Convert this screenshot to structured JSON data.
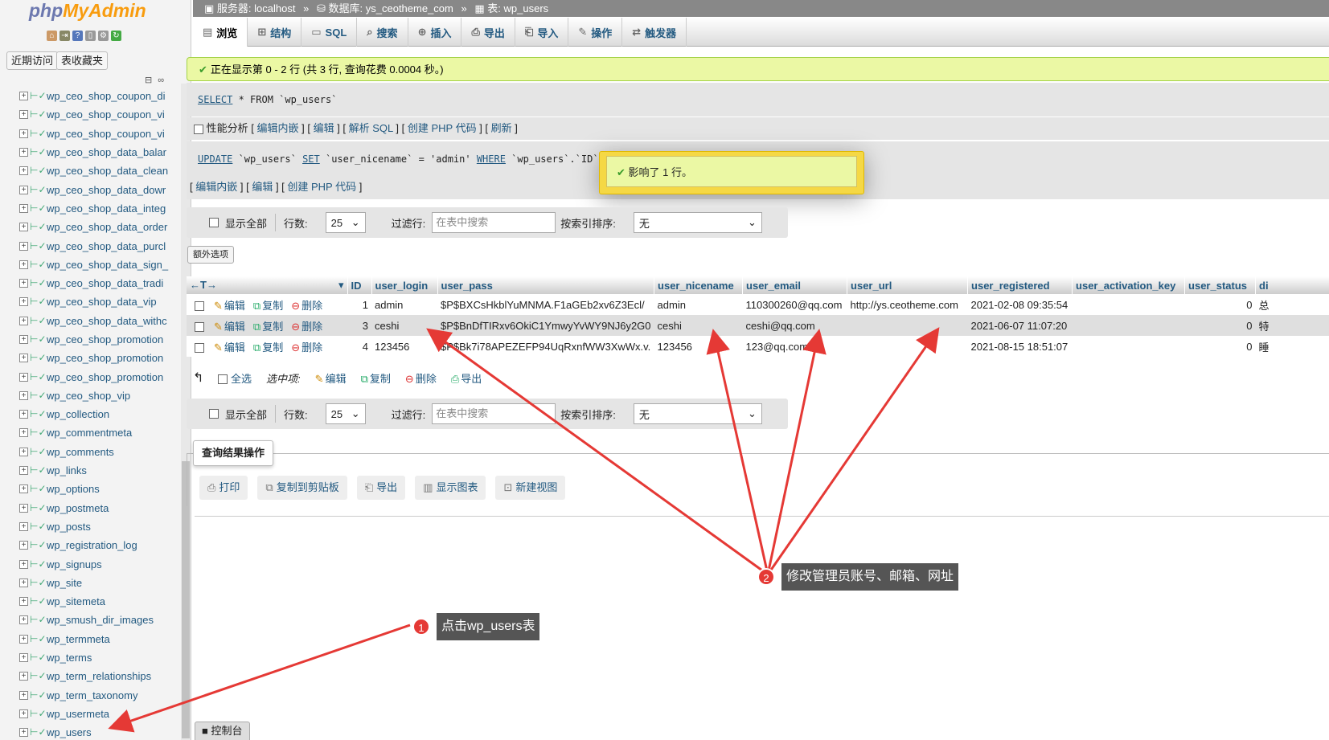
{
  "app": {
    "logo_a": "php",
    "logo_b": "MyAdmin"
  },
  "nav": {
    "tab_recent": "近期访问",
    "tab_favorites": "表收藏夹",
    "tables": [
      "wp_ceo_shop_coupon_di",
      "wp_ceo_shop_coupon_vi",
      "wp_ceo_shop_coupon_vi",
      "wp_ceo_shop_data_balar",
      "wp_ceo_shop_data_clean",
      "wp_ceo_shop_data_dowr",
      "wp_ceo_shop_data_integ",
      "wp_ceo_shop_data_order",
      "wp_ceo_shop_data_purcl",
      "wp_ceo_shop_data_sign_",
      "wp_ceo_shop_data_tradi",
      "wp_ceo_shop_data_vip",
      "wp_ceo_shop_data_withc",
      "wp_ceo_shop_promotion",
      "wp_ceo_shop_promotion",
      "wp_ceo_shop_promotion",
      "wp_ceo_shop_vip",
      "wp_collection",
      "wp_commentmeta",
      "wp_comments",
      "wp_links",
      "wp_options",
      "wp_postmeta",
      "wp_posts",
      "wp_registration_log",
      "wp_signups",
      "wp_site",
      "wp_sitemeta",
      "wp_smush_dir_images",
      "wp_termmeta",
      "wp_terms",
      "wp_term_relationships",
      "wp_term_taxonomy",
      "wp_usermeta",
      "wp_users"
    ]
  },
  "breadcrumb": {
    "server_label": "服务器:",
    "server": "localhost",
    "db_label": "数据库:",
    "db": "ys_ceotheme_com",
    "table_label": "表:",
    "table": "wp_users"
  },
  "tabs": [
    "浏览",
    "结构",
    "SQL",
    "搜索",
    "插入",
    "导出",
    "导入",
    "操作",
    "触发器"
  ],
  "messages": {
    "showing": "正在显示第 0 - 2 行 (共 3 行, 查询花费 0.0004 秒。)",
    "sql_select": [
      "SELECT",
      " * FROM `wp_users`"
    ],
    "profiling": "性能分析",
    "profile_links": [
      "编辑内嵌",
      "编辑",
      "解析 SQL",
      "创建 PHP 代码",
      "刷新"
    ],
    "sql_update": [
      "UPDATE",
      " `wp_users` ",
      "SET",
      " `user_nicename` = 'admin' ",
      "WHERE",
      " `wp_users`.`ID` = 1;"
    ],
    "update_links": [
      "编辑内嵌",
      "编辑",
      "创建 PHP 代码"
    ],
    "affected": "影响了 1 行。"
  },
  "navbar": {
    "show_all": "显示全部",
    "rows_label": "行数:",
    "rows_value": "25",
    "filter_label": "过滤行:",
    "filter_placeholder": "在表中搜索",
    "sort_label": "按索引排序:",
    "sort_value": "无",
    "extra_options": "额外选项"
  },
  "table": {
    "headers": [
      "ID",
      "user_login",
      "user_pass",
      "user_nicename",
      "user_email",
      "user_url",
      "user_registered",
      "user_activation_key",
      "user_status",
      "di"
    ],
    "actions": {
      "edit": "编辑",
      "copy": "复制",
      "delete": "删除"
    },
    "rows": [
      {
        "id": "1",
        "login": "admin",
        "pass": "$P$BXCsHkblYuMNMA.F1aGEb2xv6Z3Ecl/",
        "nicename": "admin",
        "email": "110300260@qq.com",
        "url": "http://ys.ceotheme.com",
        "registered": "2021-02-08 09:35:54",
        "key": "",
        "status": "0",
        "di": "总"
      },
      {
        "id": "3",
        "login": "ceshi",
        "pass": "$P$BnDfTIRxv6OkiC1YmwyYvWY9NJ6y2G0",
        "nicename": "ceshi",
        "email": "ceshi@qq.com",
        "url": "",
        "registered": "2021-06-07 11:07:20",
        "key": "",
        "status": "0",
        "di": "特"
      },
      {
        "id": "4",
        "login": "123456",
        "pass": "$P$Bk7i78APEZEFP94UqRxnfWW3XwWx.v.",
        "nicename": "123456",
        "email": "123@qq.com",
        "url": "",
        "registered": "2021-08-15 18:51:07",
        "key": "",
        "status": "0",
        "di": "睡"
      }
    ]
  },
  "with_selected": {
    "select_all": "全选",
    "label": "选中项:",
    "edit": "编辑",
    "copy": "复制",
    "delete": "删除",
    "export": "导出"
  },
  "query_ops": {
    "legend": "查询结果操作",
    "buttons": [
      "打印",
      "复制到剪贴板",
      "导出",
      "显示图表",
      "新建视图"
    ]
  },
  "console": "控制台",
  "annotations": {
    "a1_num": "1",
    "a1_text": "点击wp_users表",
    "a2_num": "2",
    "a2_text": "修改管理员账号、邮箱、网址"
  }
}
